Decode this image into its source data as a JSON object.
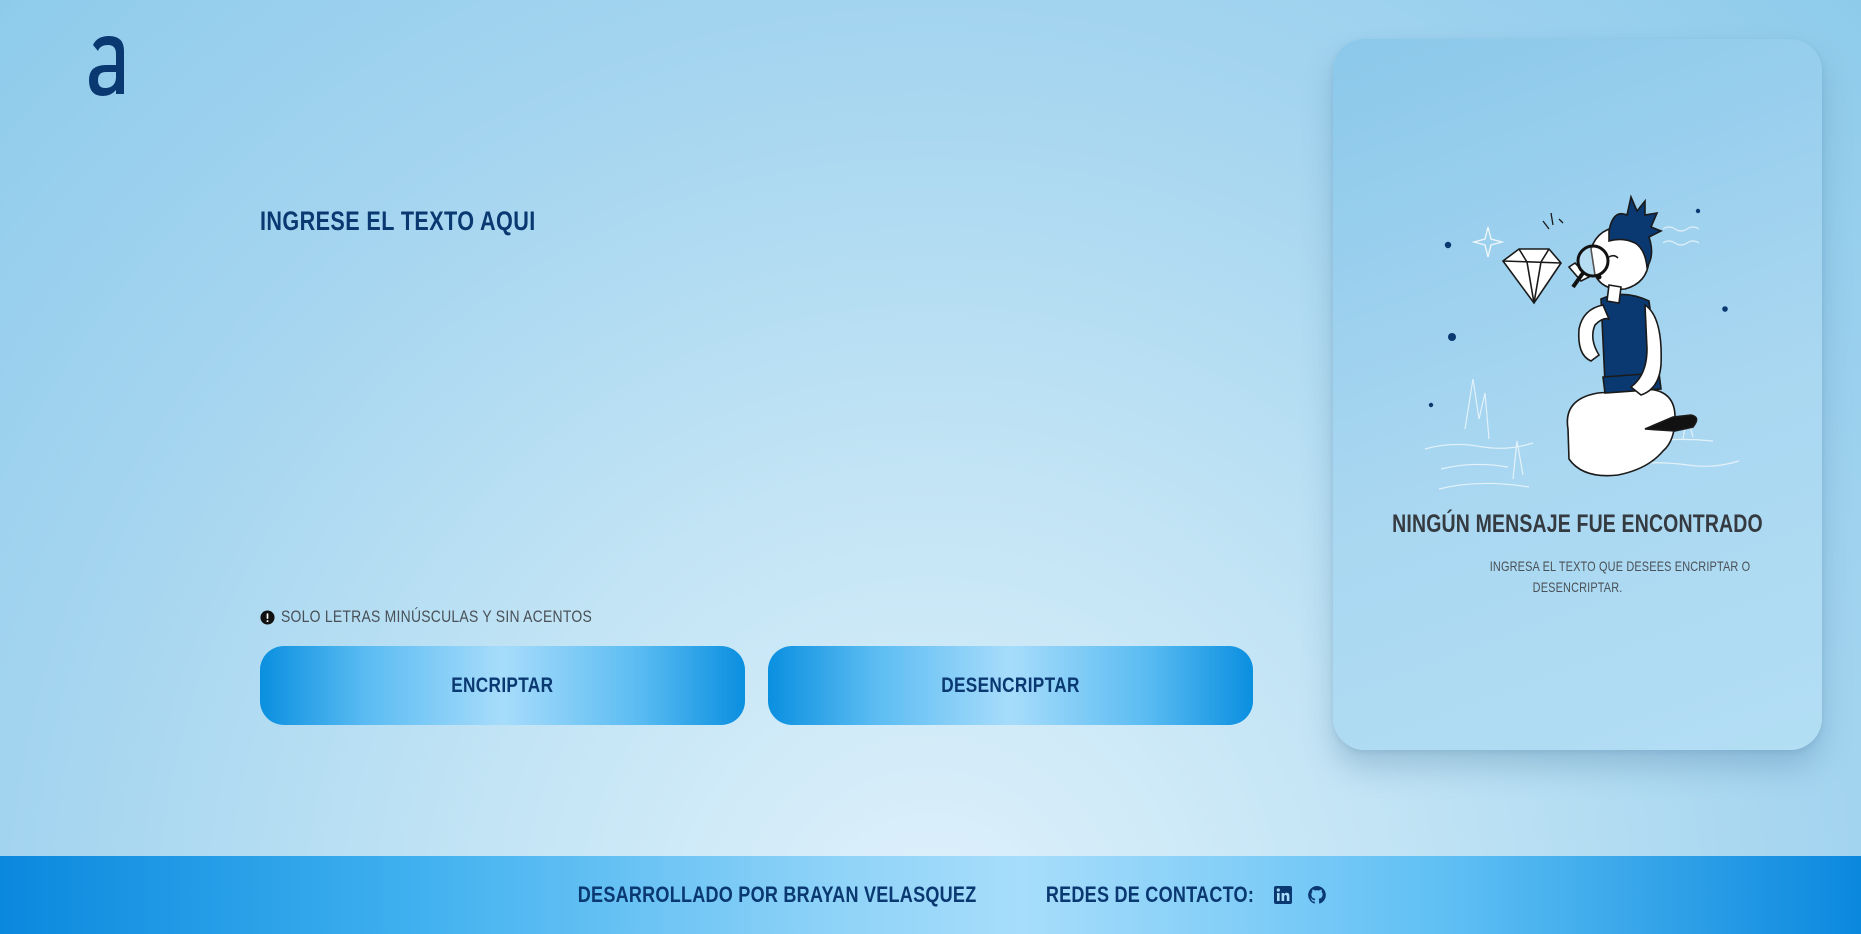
{
  "brand": {
    "logo_icon": "alura-a-logo-icon",
    "color": "#0a3871"
  },
  "input": {
    "title": "INGRESE EL TEXTO AQUI",
    "value": ""
  },
  "notice": {
    "icon": "exclamation-circle-icon",
    "text": "SOLO LETRAS MINÚSCULAS Y SIN ACENTOS"
  },
  "buttons": {
    "encrypt_label": "ENCRIPTAR",
    "decrypt_label": "DESENCRIPTAR"
  },
  "panel": {
    "illustration": "person-with-magnifying-glass-illustration",
    "title": "NINGÚN MENSAJE FUE ENCONTRADO",
    "text_line1": "INGRESA EL TEXTO QUE DESEES ENCRIPTAR O",
    "text_line2": "DESENCRIPTAR."
  },
  "footer": {
    "credit": "DESARROLLADO POR BRAYAN VELASQUEZ",
    "contact_label": "REDES DE CONTACTO:",
    "social_icons": [
      "linkedin-icon",
      "github-icon"
    ]
  },
  "colors": {
    "accent": "#0a3871",
    "button_edge": "#0a8fe0",
    "button_center": "#a7dcfb",
    "text_muted": "#495057",
    "panel_title": "#343a40"
  }
}
